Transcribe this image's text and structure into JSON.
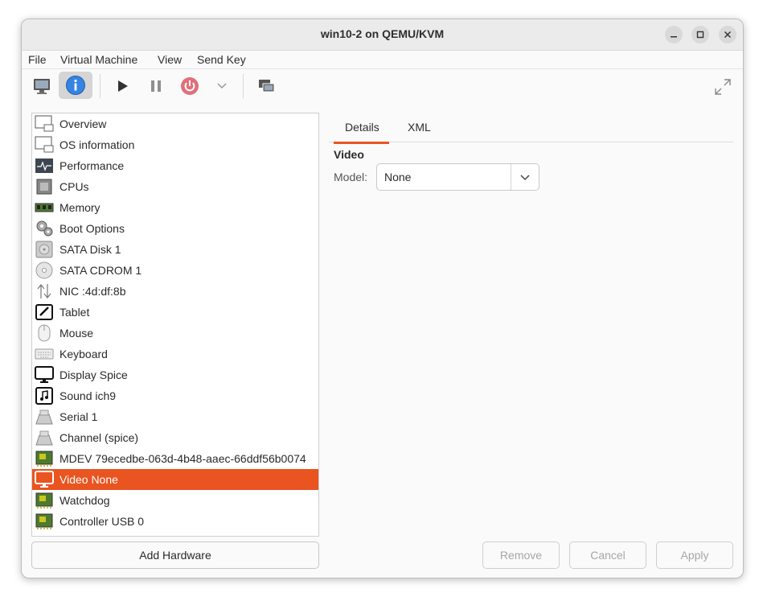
{
  "window": {
    "title": "win10-2 on QEMU/KVM"
  },
  "menubar": [
    "File",
    "Virtual Machine",
    "View",
    "Send Key"
  ],
  "toolbar": {
    "icons": [
      "monitor-icon",
      "info-icon",
      "play-icon",
      "pause-icon",
      "power-icon",
      "chevron-down-icon",
      "screenshot-icon",
      "fullscreen-icon"
    ]
  },
  "sidebar": {
    "items": [
      {
        "label": "Overview",
        "icon": "monitor-icon"
      },
      {
        "label": "OS information",
        "icon": "monitor-icon"
      },
      {
        "label": "Performance",
        "icon": "performance-icon"
      },
      {
        "label": "CPUs",
        "icon": "cpu-icon"
      },
      {
        "label": "Memory",
        "icon": "memory-icon"
      },
      {
        "label": "Boot Options",
        "icon": "gears-icon"
      },
      {
        "label": "SATA Disk 1",
        "icon": "disk-icon"
      },
      {
        "label": "SATA CDROM 1",
        "icon": "cdrom-icon"
      },
      {
        "label": "NIC :4d:df:8b",
        "icon": "network-icon"
      },
      {
        "label": "Tablet",
        "icon": "tablet-icon"
      },
      {
        "label": "Mouse",
        "icon": "mouse-icon"
      },
      {
        "label": "Keyboard",
        "icon": "keyboard-icon"
      },
      {
        "label": "Display Spice",
        "icon": "display-icon"
      },
      {
        "label": "Sound ich9",
        "icon": "sound-icon"
      },
      {
        "label": "Serial 1",
        "icon": "serial-icon"
      },
      {
        "label": "Channel (spice)",
        "icon": "serial-icon"
      },
      {
        "label": "MDEV 79ecedbe-063d-4b48-aaec-66ddf56b0074",
        "icon": "pci-card-icon"
      },
      {
        "label": "Video None",
        "icon": "video-icon",
        "selected": true
      },
      {
        "label": "Watchdog",
        "icon": "pci-card-icon"
      },
      {
        "label": "Controller USB 0",
        "icon": "pci-card-icon"
      }
    ],
    "add_hardware_label": "Add Hardware"
  },
  "details": {
    "tabs": [
      "Details",
      "XML"
    ],
    "active_tab": "Details",
    "section_title": "Video",
    "model_label": "Model:",
    "model_value": "None"
  },
  "buttons": {
    "remove": "Remove",
    "cancel": "Cancel",
    "apply": "Apply"
  },
  "colors": {
    "accent": "#e95420",
    "info_blue": "#3584e4",
    "power_red": "#e0707a"
  }
}
